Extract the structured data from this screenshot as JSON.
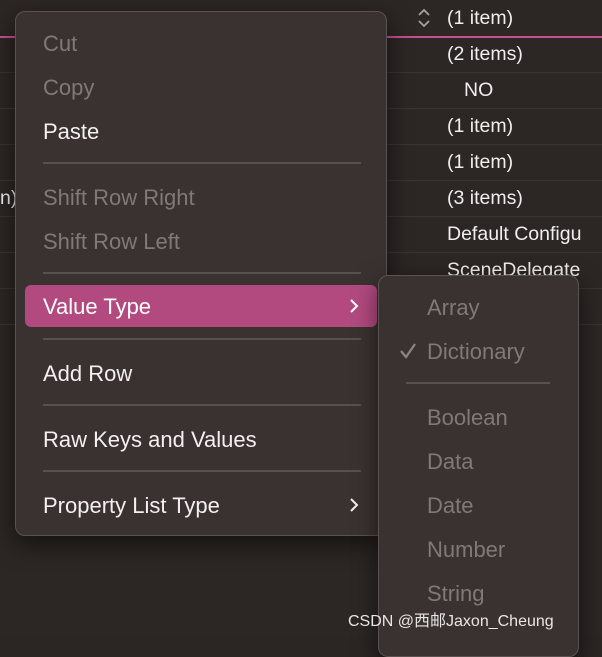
{
  "plist": {
    "rows": [
      {
        "value": "(1 item)"
      },
      {
        "value": "(2 items)"
      },
      {
        "value": "NO"
      },
      {
        "value": "(1 item)"
      },
      {
        "value": "(1 item)"
      },
      {
        "value": "(3 items)",
        "left_fragment": "n)"
      },
      {
        "value": "Default Configu"
      },
      {
        "value": "SceneDelegate"
      }
    ]
  },
  "context_menu": {
    "cut": "Cut",
    "copy": "Copy",
    "paste": "Paste",
    "shift_row_right": "Shift Row Right",
    "shift_row_left": "Shift Row Left",
    "value_type": "Value Type",
    "add_row": "Add Row",
    "raw_keys_and_values": "Raw Keys and Values",
    "property_list_type": "Property List Type"
  },
  "value_type_submenu": {
    "array": "Array",
    "dictionary": "Dictionary",
    "boolean": "Boolean",
    "data": "Data",
    "date": "Date",
    "number": "Number",
    "string": "String",
    "checked": "Dictionary"
  },
  "watermark": "CSDN @西邮Jaxon_Cheung",
  "colors": {
    "highlight": "#b24a7f",
    "selection_line": "#c64f8f",
    "menu_bg": "#3a3230"
  }
}
